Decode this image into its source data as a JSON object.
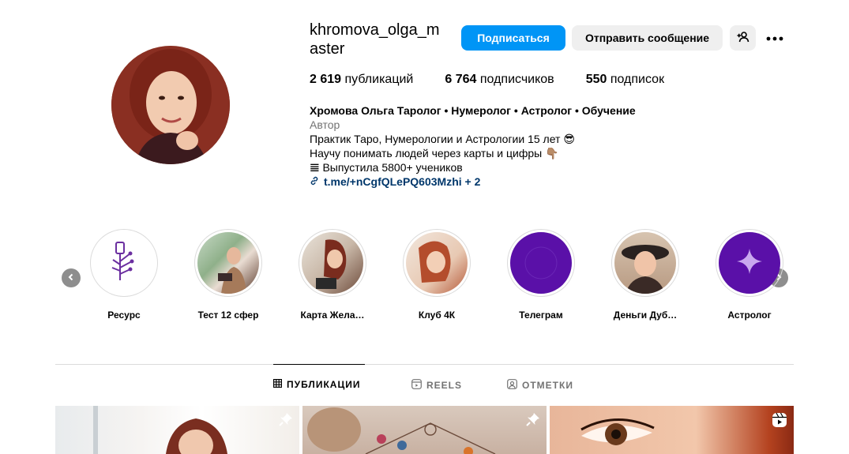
{
  "profile": {
    "username": "khromova_olga_master",
    "follow_label": "Подписаться",
    "message_label": "Отправить сообщение",
    "suggest_icon": "add-person-icon",
    "more_icon": "more-dots-icon"
  },
  "stats": {
    "posts_count": "2 619",
    "posts_label": "публикаций",
    "followers_count": "6 764",
    "followers_label": "подписчиков",
    "following_count": "550",
    "following_label": "подписок"
  },
  "bio": {
    "name": "Хромова Ольга Таролог • Нумеролог • Астролог • Обучение",
    "category": "Автор",
    "line1": "Практик Таро, Нумерологии и Астрологии 15 лет 😎",
    "line2": "Научу понимать людей через карты и цифры 👇🏽",
    "line3": "𝌆 Выпустила 5800+ учеников",
    "link": "t.me/+nCgfQLePQ603Mzhi + 2"
  },
  "highlights": [
    {
      "label": "Ресурс"
    },
    {
      "label": "Тест 12 сфер"
    },
    {
      "label": "Карта Жела…"
    },
    {
      "label": "Клуб 4К"
    },
    {
      "label": "Телеграм"
    },
    {
      "label": "Деньги Дуб…"
    },
    {
      "label": "Астролог"
    }
  ],
  "tabs": {
    "posts": "ПУБЛИКАЦИИ",
    "reels": "REELS",
    "tagged": "ОТМЕТКИ"
  },
  "colors": {
    "accent": "#0095f6",
    "highlight_purple": "#5a10a8",
    "link": "#00376b"
  }
}
